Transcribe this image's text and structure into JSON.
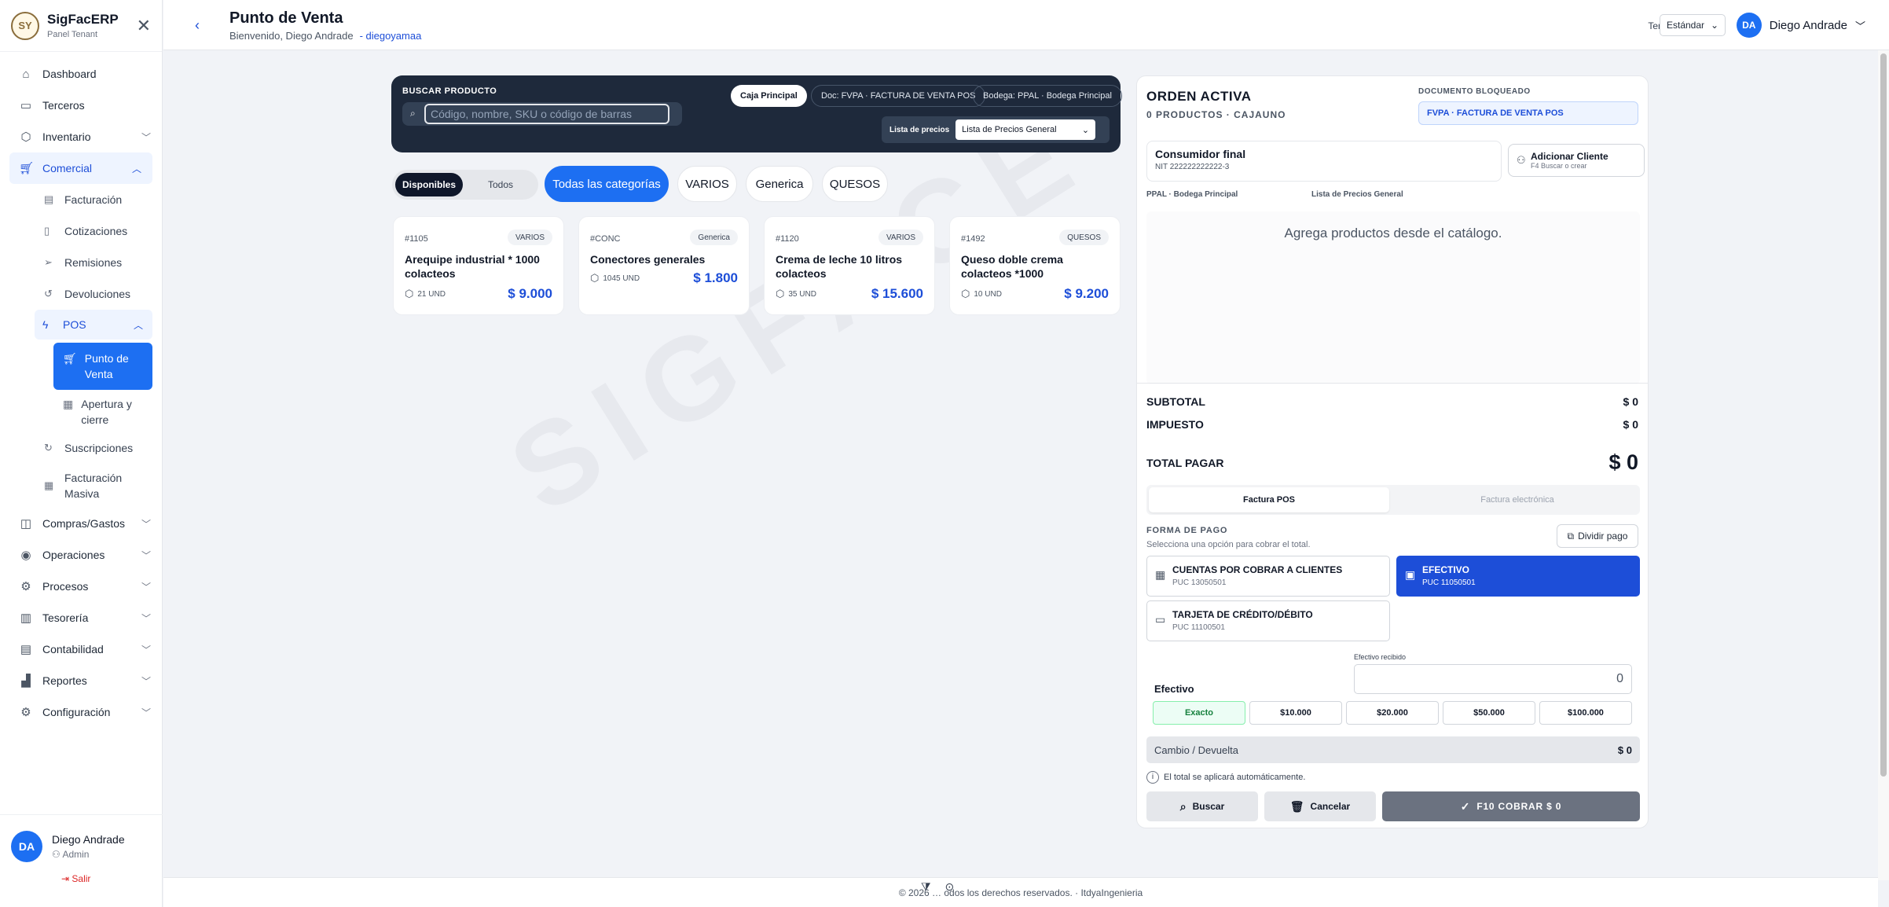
{
  "sidebar": {
    "brand": "SigFacERP",
    "brand_sub": "Panel Tenant",
    "items": [
      {
        "label": "Dashboard"
      },
      {
        "label": "Terceros"
      },
      {
        "label": "Inventario"
      },
      {
        "label": "Comercial"
      }
    ],
    "comercial_sub": [
      "Facturación",
      "Cotizaciones",
      "Remisiones",
      "Devoluciones"
    ],
    "pos_label": "POS",
    "pos_sub": [
      "Punto de Venta",
      "Apertura y cierre"
    ],
    "comercial_sub_after": [
      "Suscripciones",
      "Facturación Masiva"
    ],
    "items_after": [
      {
        "label": "Compras/Gastos"
      },
      {
        "label": "Operaciones"
      },
      {
        "label": "Procesos"
      },
      {
        "label": "Tesorería"
      },
      {
        "label": "Contabilidad"
      },
      {
        "label": "Reportes"
      },
      {
        "label": "Configuración"
      }
    ],
    "user": {
      "initials": "DA",
      "name": "Diego Andrade",
      "role": "Admin",
      "logout": "Salir"
    }
  },
  "header": {
    "title": "Punto de Venta",
    "welcome": "Bienvenido, Diego Andrade",
    "tenant": "- diegoyamaa",
    "tema_label": "Tema:",
    "tema_value": "Estándar",
    "user_initials": "DA",
    "user_name": "Diego Andrade"
  },
  "search": {
    "label": "BUSCAR PRODUCTO",
    "placeholder": "Código, nombre, SKU o código de barras",
    "caja": "Caja Principal",
    "doc": "Doc: FVPA · FACTURA DE VENTA POS",
    "bodega": "Bodega: PPAL · Bodega Principal",
    "price_list_label": "Lista de precios",
    "price_list_value": "Lista de Precios General"
  },
  "filters": {
    "availability": [
      "Disponibles",
      "Todos"
    ],
    "categories": [
      "Todas las categorías",
      "VARIOS",
      "Generica",
      "QUESOS"
    ]
  },
  "products": [
    {
      "code": "#1105",
      "tag": "VARIOS",
      "name": "Arequipe industrial * 1000 colacteos",
      "stock": "21 UND",
      "price": "$ 9.000"
    },
    {
      "code": "#CONC",
      "tag": "Generica",
      "name": "Conectores generales",
      "stock": "1045 UND",
      "price": "$ 1.800"
    },
    {
      "code": "#1120",
      "tag": "VARIOS",
      "name": "Crema de leche 10 litros colacteos",
      "stock": "35 UND",
      "price": "$ 15.600"
    },
    {
      "code": "#1492",
      "tag": "QUESOS",
      "name": "Queso doble crema colacteos *1000",
      "stock": "10 UND",
      "price": "$ 9.200"
    }
  ],
  "order": {
    "title": "ORDEN ACTIVA",
    "sub": "0 PRODUCTOS · CAJAUNO",
    "doc_label": "DOCUMENTO BLOQUEADO",
    "doc_value": "FVPA · FACTURA DE VENTA POS",
    "customer_name": "Consumidor final",
    "customer_nit": "NIT 222222222222-3",
    "add_client": "Adicionar Cliente",
    "add_client_hint": "F4 Buscar o crear",
    "bodega": "PPAL · Bodega Principal",
    "price_list": "Lista de Precios General",
    "empty": "Agrega productos desde el catálogo.",
    "subtotal_label": "SUBTOTAL",
    "subtotal": "$ 0",
    "impuesto_label": "IMPUESTO",
    "impuesto": "$ 0",
    "total_label": "TOTAL PAGAR",
    "total": "$ 0",
    "tab_pos": "Factura POS",
    "tab_elec": "Factura electrónica",
    "fp_label": "FORMA DE PAGO",
    "fp_hint": "Selecciona una opción para cobrar el total.",
    "divide": "Dividir pago",
    "methods": [
      {
        "title": "CUENTAS POR COBRAR A CLIENTES",
        "puc": "PUC 13050501"
      },
      {
        "title": "EFECTIVO",
        "puc": "PUC 11050501"
      },
      {
        "title": "TARJETA DE CRÉDITO/DÉBITO",
        "puc": "PUC 11100501"
      }
    ],
    "efectivo_label": "Efectivo",
    "recibido_label": "Efectivo recibido",
    "recibido_value": "0",
    "quick": [
      "Exacto",
      "$10.000",
      "$20.000",
      "$50.000",
      "$100.000"
    ],
    "cambio_label": "Cambio / Devuelta",
    "cambio_value": "$ 0",
    "info": "El total se aplicará automáticamente.",
    "btn_buscar": "Buscar",
    "btn_cancelar": "Cancelar",
    "btn_cobrar": "F10 COBRAR $ 0"
  },
  "footer": {
    "text": "© 2026 … odos los derechos reservados. · ItdyaIngenieria"
  },
  "watermark": "SIGFACE",
  "colors": {
    "accent": "#1d6ff2",
    "dark_panel": "#1e293b",
    "price": "#1d4ed8"
  }
}
